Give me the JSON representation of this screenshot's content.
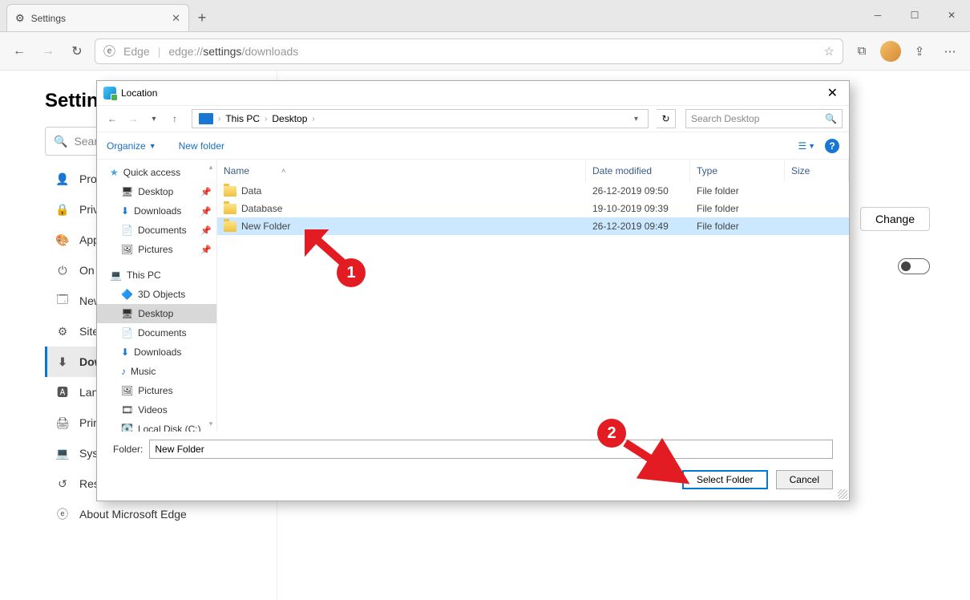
{
  "browser": {
    "tab_title": "Settings",
    "url_prefix": "Edge",
    "url_proto": "edge://",
    "url_bold": "settings",
    "url_rest": "/downloads"
  },
  "settings": {
    "heading": "Settings",
    "search_placeholder": "Search settings",
    "items": [
      {
        "icon": "👤",
        "label": "Profiles"
      },
      {
        "icon": "🔒",
        "label": "Privacy and services"
      },
      {
        "icon": "🎨",
        "label": "Appearance"
      },
      {
        "icon": "⏻",
        "label": "On startup"
      },
      {
        "icon": "🗔",
        "label": "New tab page"
      },
      {
        "icon": "⚙",
        "label": "Site permissions"
      },
      {
        "icon": "⬇",
        "label": "Downloads",
        "selected": true
      },
      {
        "icon": "🅰",
        "label": "Languages"
      },
      {
        "icon": "🖨",
        "label": "Printers"
      },
      {
        "icon": "💻",
        "label": "System"
      },
      {
        "icon": "↺",
        "label": "Reset settings"
      },
      {
        "icon": "ⓔ",
        "label": "About Microsoft Edge"
      }
    ],
    "change_btn": "Change"
  },
  "dialog": {
    "title": "Location",
    "breadcrumb": [
      "This PC",
      "Desktop"
    ],
    "search_placeholder": "Search Desktop",
    "organize": "Organize",
    "new_folder_btn": "New folder",
    "tree": [
      {
        "icon": "ico-star",
        "label": "Quick access",
        "indent": false
      },
      {
        "icon": "ico-desktop",
        "label": "Desktop",
        "indent": true,
        "pin": true
      },
      {
        "icon": "ico-dl",
        "label": "Downloads",
        "indent": true,
        "pin": true
      },
      {
        "icon": "ico-doc",
        "label": "Documents",
        "indent": true,
        "pin": true
      },
      {
        "icon": "ico-pic",
        "label": "Pictures",
        "indent": true,
        "pin": true
      },
      {
        "icon": "ico-pc",
        "label": "This PC",
        "indent": false,
        "mt": true
      },
      {
        "icon": "ico-3d",
        "label": "3D Objects",
        "indent": true
      },
      {
        "icon": "ico-desktop",
        "label": "Desktop",
        "indent": true,
        "selected": true
      },
      {
        "icon": "ico-doc",
        "label": "Documents",
        "indent": true
      },
      {
        "icon": "ico-dl",
        "label": "Downloads",
        "indent": true
      },
      {
        "icon": "ico-music",
        "label": "Music",
        "indent": true
      },
      {
        "icon": "ico-pic",
        "label": "Pictures",
        "indent": true
      },
      {
        "icon": "ico-vid",
        "label": "Videos",
        "indent": true
      },
      {
        "icon": "ico-disk",
        "label": "Local Disk (C:)",
        "indent": true
      }
    ],
    "columns": {
      "name": "Name",
      "date": "Date modified",
      "type": "Type",
      "size": "Size"
    },
    "rows": [
      {
        "name": "Data",
        "date": "26-12-2019 09:50",
        "type": "File folder"
      },
      {
        "name": "Database",
        "date": "19-10-2019 09:39",
        "type": "File folder"
      },
      {
        "name": "New Folder",
        "date": "26-12-2019 09:49",
        "type": "File folder",
        "selected": true
      }
    ],
    "folder_label": "Folder:",
    "folder_value": "New Folder",
    "select_btn": "Select Folder",
    "cancel_btn": "Cancel"
  },
  "callouts": {
    "one": "1",
    "two": "2"
  }
}
